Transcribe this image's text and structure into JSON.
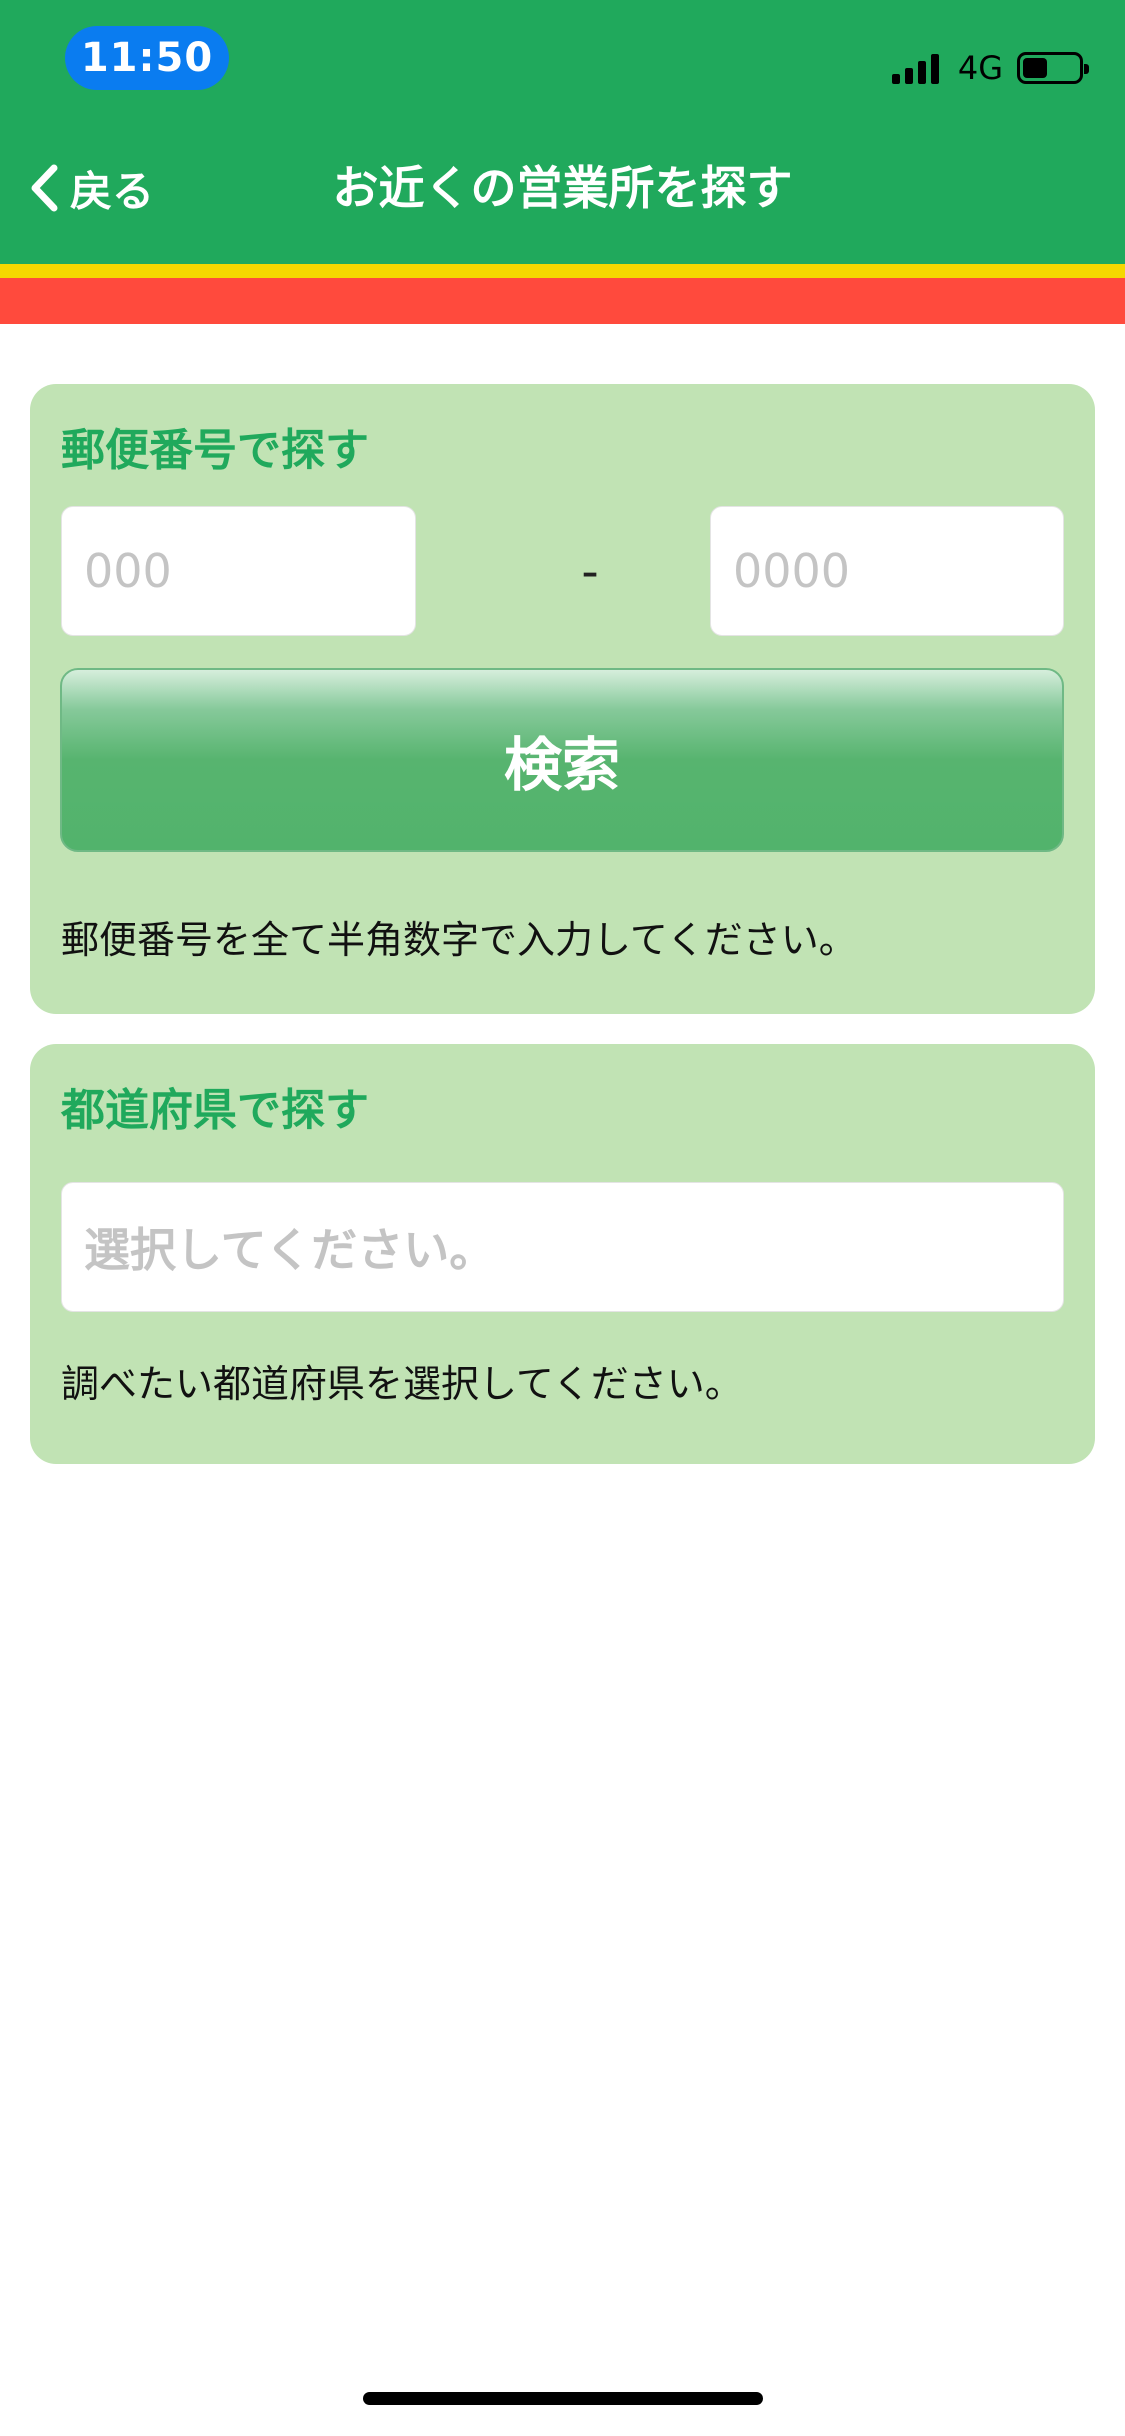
{
  "status_bar": {
    "time": "11:50",
    "network": "4G",
    "battery_level": 0.45,
    "signal_bars": 4
  },
  "nav": {
    "back_label": "戻る",
    "title": "お近くの営業所を探す"
  },
  "postal_search": {
    "title": "郵便番号で探す",
    "zip_first_placeholder": "000",
    "zip_separator": "-",
    "zip_second_placeholder": "0000",
    "search_button_label": "検索",
    "hint": "郵便番号を全て半角数字で入力してください。"
  },
  "prefecture_search": {
    "title": "都道府県で探す",
    "select_placeholder": "選択してください。",
    "hint": "調べたい都道府県を選択してください。"
  },
  "colors": {
    "header_green": "#20a95c",
    "stripe_yellow": "#f5d800",
    "stripe_red": "#ff4a3d",
    "card_background": "#c1e3b4",
    "time_pill_blue": "#0a7cf0"
  },
  "icons": {
    "back": "chevron-left-icon",
    "signal": "cellular-signal-icon",
    "battery": "battery-icon"
  }
}
